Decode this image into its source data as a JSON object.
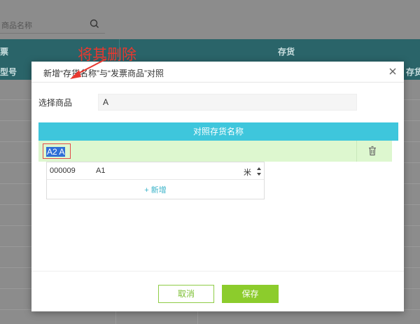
{
  "background": {
    "search_placeholder": "商品名称",
    "table_header_left": "票",
    "table_header_right": "存货",
    "subheader_left": "型号",
    "subheader_right": "存货单位"
  },
  "dialog": {
    "title": "新增“存货名称”与“发票商品”对照",
    "select_goods_label": "选择商品",
    "select_goods_value": "A",
    "mapping_header": "对照存货名称",
    "mapping_row_value": "A2 A",
    "dropdown": {
      "items": [
        {
          "code": "000009",
          "name": "A1",
          "unit": "米"
        }
      ],
      "add_label": "+ 新增"
    },
    "cancel_label": "取消",
    "save_label": "保存"
  },
  "annotation": {
    "text": "将其删除",
    "color": "#e8382f"
  },
  "colors": {
    "header_cyan": "#3ec6dc",
    "row_green": "#ddf7cf",
    "button_green": "#8ccc2c",
    "bg_teal": "#2a6469"
  },
  "icons": {
    "search": "search-icon",
    "close": "close-icon",
    "delete": "trash-icon",
    "spinner": "spinner-icon"
  }
}
